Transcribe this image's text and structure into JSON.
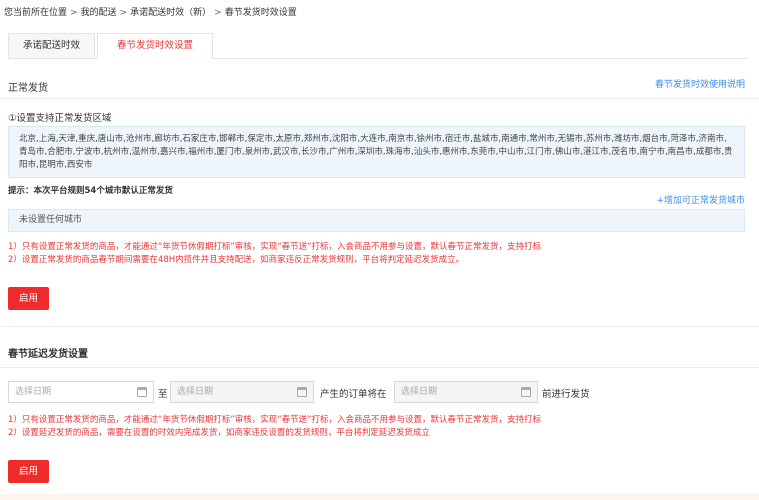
{
  "breadcrumb": {
    "items": [
      "您当前所在位置",
      "我的配送",
      "承诺配送时效（新）",
      "春节发货时效设置"
    ],
    "separator": ">"
  },
  "tabs": [
    {
      "label": "承诺配送时效",
      "active": false
    },
    {
      "label": "春节发货时效设置",
      "active": true
    }
  ],
  "normal": {
    "title": "正常发货",
    "help_link": "春节发货时效使用说明",
    "step_label": "①设置支持正常发货区域",
    "cities": "北京,上海,天津,重庆,唐山市,沧州市,廊坊市,石家庄市,邯郸市,保定市,太原市,郑州市,沈阳市,大连市,南京市,徐州市,宿迁市,盐城市,南通市,常州市,无锡市,苏州市,潍坊市,烟台市,菏泽市,济南市,青岛市,合肥市,宁波市,杭州市,温州市,嘉兴市,福州市,厦门市,泉州市,武汉市,长沙市,广州市,深圳市,珠海市,汕头市,惠州市,东莞市,中山市,江门市,佛山市,湛江市,茂名市,南宁市,南昌市,成都市,贵阳市,昆明市,西安市",
    "hint": "提示：本次平台规则54个城市默认正常发货",
    "add_city": "+增加可正常发货城市",
    "empty": "未设置任何城市",
    "notes": [
      "1）只有设置正常发货的商品，才能通过“年货节休假期打标”审核，实现“春节送”打标，入会商品不用参与设置，默认春节正常发货，支持打标",
      "2）设置正常发货的商品春节期间需要在48H内揽件并且支持配送，如商家违反正常发货规则，平台将判定延迟发货成立。"
    ],
    "button": "启用"
  },
  "delay": {
    "title": "春节延迟发货设置",
    "placeholder": "选择日期",
    "to": "至",
    "mid": "产生的订单将在",
    "end": "前进行发货",
    "notes": [
      "1）只有设置正常发货的商品，才能通过“年货节休假期打标”审核，实现“春节送”打标，入会商品不用参与设置，默认春节正常发货，支持打标",
      "2）设置延迟发货的商品，需要在设置的时效内完成发货，如商家违反设置的发货规则，平台将判定延迟发货成立"
    ],
    "button": "启用"
  },
  "colors": {
    "accent": "#e8363a",
    "link": "#3a8ee6",
    "button": "#f02b2b",
    "info_bg": "#eef6fc"
  },
  "icons": {
    "date": "calendar-icon"
  }
}
